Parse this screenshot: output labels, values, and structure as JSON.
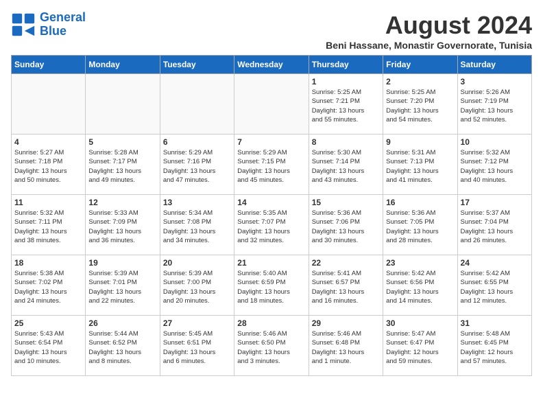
{
  "logo": {
    "line1": "General",
    "line2": "Blue"
  },
  "title": "August 2024",
  "location": "Beni Hassane, Monastir Governorate, Tunisia",
  "days_of_week": [
    "Sunday",
    "Monday",
    "Tuesday",
    "Wednesday",
    "Thursday",
    "Friday",
    "Saturday"
  ],
  "weeks": [
    [
      {
        "day": "",
        "info": ""
      },
      {
        "day": "",
        "info": ""
      },
      {
        "day": "",
        "info": ""
      },
      {
        "day": "",
        "info": ""
      },
      {
        "day": "1",
        "info": "Sunrise: 5:25 AM\nSunset: 7:21 PM\nDaylight: 13 hours\nand 55 minutes."
      },
      {
        "day": "2",
        "info": "Sunrise: 5:25 AM\nSunset: 7:20 PM\nDaylight: 13 hours\nand 54 minutes."
      },
      {
        "day": "3",
        "info": "Sunrise: 5:26 AM\nSunset: 7:19 PM\nDaylight: 13 hours\nand 52 minutes."
      }
    ],
    [
      {
        "day": "4",
        "info": "Sunrise: 5:27 AM\nSunset: 7:18 PM\nDaylight: 13 hours\nand 50 minutes."
      },
      {
        "day": "5",
        "info": "Sunrise: 5:28 AM\nSunset: 7:17 PM\nDaylight: 13 hours\nand 49 minutes."
      },
      {
        "day": "6",
        "info": "Sunrise: 5:29 AM\nSunset: 7:16 PM\nDaylight: 13 hours\nand 47 minutes."
      },
      {
        "day": "7",
        "info": "Sunrise: 5:29 AM\nSunset: 7:15 PM\nDaylight: 13 hours\nand 45 minutes."
      },
      {
        "day": "8",
        "info": "Sunrise: 5:30 AM\nSunset: 7:14 PM\nDaylight: 13 hours\nand 43 minutes."
      },
      {
        "day": "9",
        "info": "Sunrise: 5:31 AM\nSunset: 7:13 PM\nDaylight: 13 hours\nand 41 minutes."
      },
      {
        "day": "10",
        "info": "Sunrise: 5:32 AM\nSunset: 7:12 PM\nDaylight: 13 hours\nand 40 minutes."
      }
    ],
    [
      {
        "day": "11",
        "info": "Sunrise: 5:32 AM\nSunset: 7:11 PM\nDaylight: 13 hours\nand 38 minutes."
      },
      {
        "day": "12",
        "info": "Sunrise: 5:33 AM\nSunset: 7:09 PM\nDaylight: 13 hours\nand 36 minutes."
      },
      {
        "day": "13",
        "info": "Sunrise: 5:34 AM\nSunset: 7:08 PM\nDaylight: 13 hours\nand 34 minutes."
      },
      {
        "day": "14",
        "info": "Sunrise: 5:35 AM\nSunset: 7:07 PM\nDaylight: 13 hours\nand 32 minutes."
      },
      {
        "day": "15",
        "info": "Sunrise: 5:36 AM\nSunset: 7:06 PM\nDaylight: 13 hours\nand 30 minutes."
      },
      {
        "day": "16",
        "info": "Sunrise: 5:36 AM\nSunset: 7:05 PM\nDaylight: 13 hours\nand 28 minutes."
      },
      {
        "day": "17",
        "info": "Sunrise: 5:37 AM\nSunset: 7:04 PM\nDaylight: 13 hours\nand 26 minutes."
      }
    ],
    [
      {
        "day": "18",
        "info": "Sunrise: 5:38 AM\nSunset: 7:02 PM\nDaylight: 13 hours\nand 24 minutes."
      },
      {
        "day": "19",
        "info": "Sunrise: 5:39 AM\nSunset: 7:01 PM\nDaylight: 13 hours\nand 22 minutes."
      },
      {
        "day": "20",
        "info": "Sunrise: 5:39 AM\nSunset: 7:00 PM\nDaylight: 13 hours\nand 20 minutes."
      },
      {
        "day": "21",
        "info": "Sunrise: 5:40 AM\nSunset: 6:59 PM\nDaylight: 13 hours\nand 18 minutes."
      },
      {
        "day": "22",
        "info": "Sunrise: 5:41 AM\nSunset: 6:57 PM\nDaylight: 13 hours\nand 16 minutes."
      },
      {
        "day": "23",
        "info": "Sunrise: 5:42 AM\nSunset: 6:56 PM\nDaylight: 13 hours\nand 14 minutes."
      },
      {
        "day": "24",
        "info": "Sunrise: 5:42 AM\nSunset: 6:55 PM\nDaylight: 13 hours\nand 12 minutes."
      }
    ],
    [
      {
        "day": "25",
        "info": "Sunrise: 5:43 AM\nSunset: 6:54 PM\nDaylight: 13 hours\nand 10 minutes."
      },
      {
        "day": "26",
        "info": "Sunrise: 5:44 AM\nSunset: 6:52 PM\nDaylight: 13 hours\nand 8 minutes."
      },
      {
        "day": "27",
        "info": "Sunrise: 5:45 AM\nSunset: 6:51 PM\nDaylight: 13 hours\nand 6 minutes."
      },
      {
        "day": "28",
        "info": "Sunrise: 5:46 AM\nSunset: 6:50 PM\nDaylight: 13 hours\nand 3 minutes."
      },
      {
        "day": "29",
        "info": "Sunrise: 5:46 AM\nSunset: 6:48 PM\nDaylight: 13 hours\nand 1 minute."
      },
      {
        "day": "30",
        "info": "Sunrise: 5:47 AM\nSunset: 6:47 PM\nDaylight: 12 hours\nand 59 minutes."
      },
      {
        "day": "31",
        "info": "Sunrise: 5:48 AM\nSunset: 6:45 PM\nDaylight: 12 hours\nand 57 minutes."
      }
    ]
  ]
}
